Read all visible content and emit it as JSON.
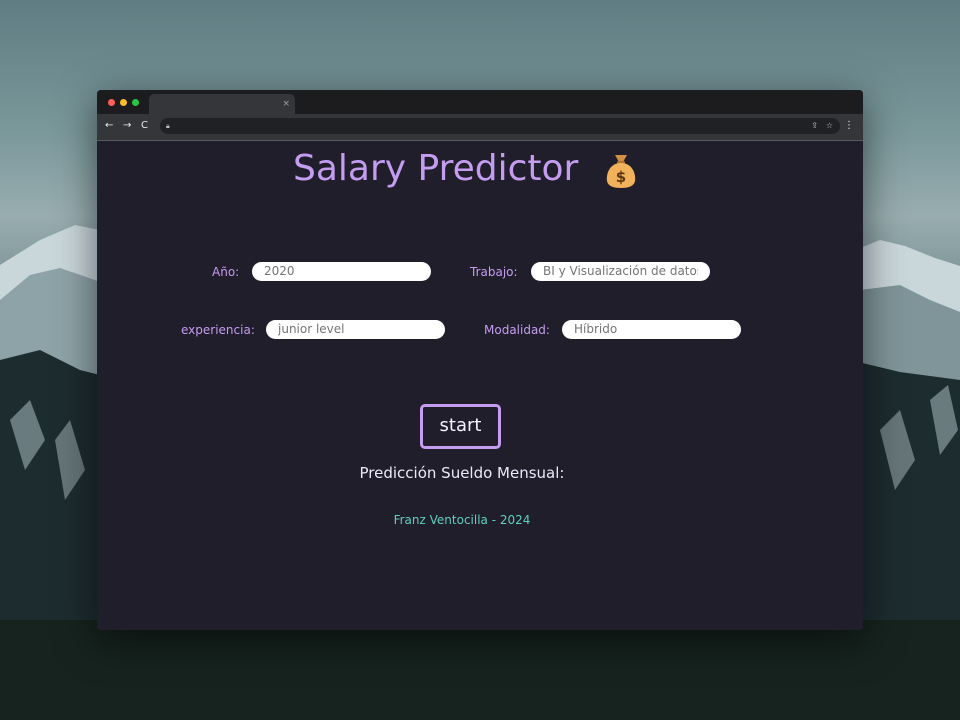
{
  "browser": {
    "tab_close": "×",
    "nav_back": "←",
    "nav_forward": "→",
    "reload": "C"
  },
  "page": {
    "title": "Salary Predictor",
    "title_icon": "money-bag-icon",
    "fields": {
      "year": {
        "label": "Año:",
        "placeholder": "2020"
      },
      "job": {
        "label": "Trabajo:",
        "placeholder": "BI y Visualización de datos"
      },
      "experience": {
        "label": "experiencia:",
        "placeholder": "junior level"
      },
      "modality": {
        "label": "Modalidad:",
        "placeholder": "Híbrido"
      }
    },
    "start_label": "start",
    "prediction_label": "Predicción Sueldo Mensual:",
    "footer": "Franz Ventocilla - 2024"
  },
  "colors": {
    "accent": "#c49cf0",
    "background": "#201e2b",
    "footer": "#5fcfc0",
    "input_bg": "#ffffff"
  }
}
